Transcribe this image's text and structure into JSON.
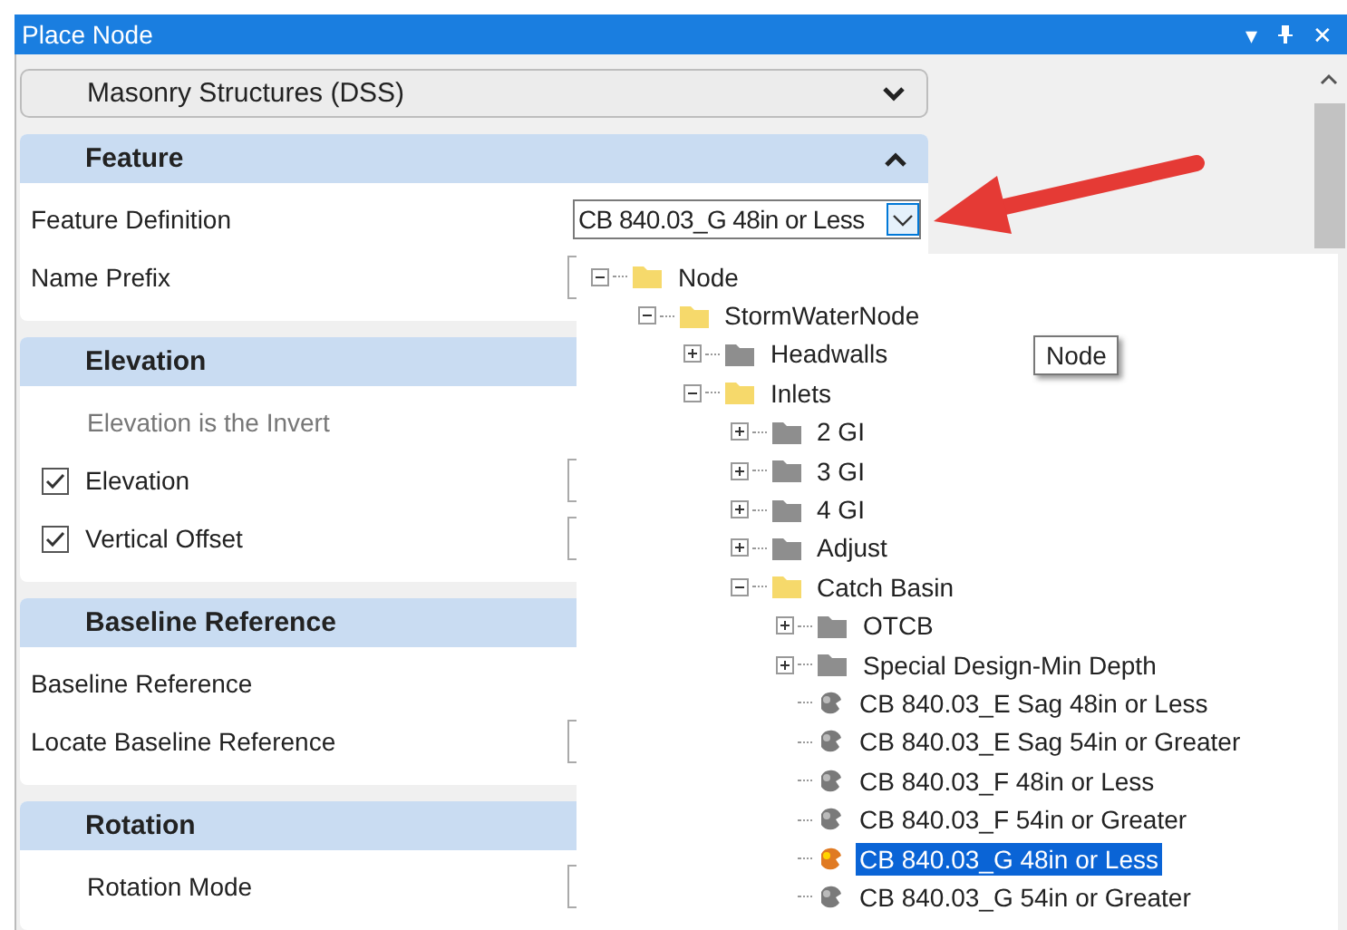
{
  "window": {
    "title": "Place Node",
    "controls": [
      "▾",
      "✕"
    ]
  },
  "dropdown": {
    "label": "Masonry Structures (DSS)"
  },
  "sections": [
    {
      "title": "Feature",
      "expanded": true,
      "toggle": true,
      "rows": [
        {
          "kind": "label",
          "label": "Feature Definition",
          "value": "CB 840.03_G 48in or Less"
        },
        {
          "kind": "label",
          "label": "Name Prefix",
          "field": true
        }
      ]
    },
    {
      "title": "Elevation",
      "expanded": true,
      "rows": [
        {
          "kind": "note",
          "label": "Elevation is the Invert"
        },
        {
          "kind": "checkbox",
          "label": "Elevation",
          "checked": true,
          "field": true
        },
        {
          "kind": "checkbox",
          "label": "Vertical Offset",
          "checked": true,
          "field": true
        }
      ]
    },
    {
      "title": "Baseline Reference",
      "expanded": true,
      "rows": [
        {
          "kind": "label",
          "label": "Baseline Reference"
        },
        {
          "kind": "label",
          "label": "Locate Baseline Reference",
          "field": true
        }
      ]
    },
    {
      "title": "Rotation",
      "expanded": true,
      "rows": [
        {
          "kind": "indented",
          "label": "Rotation Mode",
          "field": true
        }
      ]
    }
  ],
  "tree": [
    {
      "label": "Node",
      "kind": "folder",
      "expanded": true,
      "children": [
        {
          "label": "StormWaterNode",
          "kind": "folder",
          "expanded": true,
          "children": [
            {
              "label": "Headwalls",
              "kind": "folder",
              "expanded": false
            },
            {
              "label": "Inlets",
              "kind": "folder",
              "expanded": true,
              "children": [
                {
                  "label": "2 GI",
                  "kind": "folder",
                  "expanded": false
                },
                {
                  "label": "3 GI",
                  "kind": "folder",
                  "expanded": false
                },
                {
                  "label": "4 GI",
                  "kind": "folder",
                  "expanded": false
                },
                {
                  "label": "Adjust",
                  "kind": "folder",
                  "expanded": false
                },
                {
                  "label": "Catch Basin",
                  "kind": "folder",
                  "expanded": true,
                  "children": [
                    {
                      "label": "OTCB",
                      "kind": "folder",
                      "expanded": false
                    },
                    {
                      "label": "Special Design-Min Depth",
                      "kind": "folder",
                      "expanded": false
                    },
                    {
                      "label": "CB 840.03_E Sag 48in or Less",
                      "kind": "item",
                      "selected": false
                    },
                    {
                      "label": "CB 840.03_E Sag 54in or Greater",
                      "kind": "item",
                      "selected": false
                    },
                    {
                      "label": "CB 840.03_F 48in or Less",
                      "kind": "item",
                      "selected": false
                    },
                    {
                      "label": "CB 840.03_F 54in or Greater",
                      "kind": "item",
                      "selected": false
                    },
                    {
                      "label": "CB 840.03_G 48in or Less",
                      "kind": "item",
                      "selected": true
                    },
                    {
                      "label": "CB 840.03_G 54in or Greater",
                      "kind": "item",
                      "selected": false
                    }
                  ]
                }
              ]
            }
          ]
        }
      ]
    }
  ],
  "tooltip": "Node"
}
